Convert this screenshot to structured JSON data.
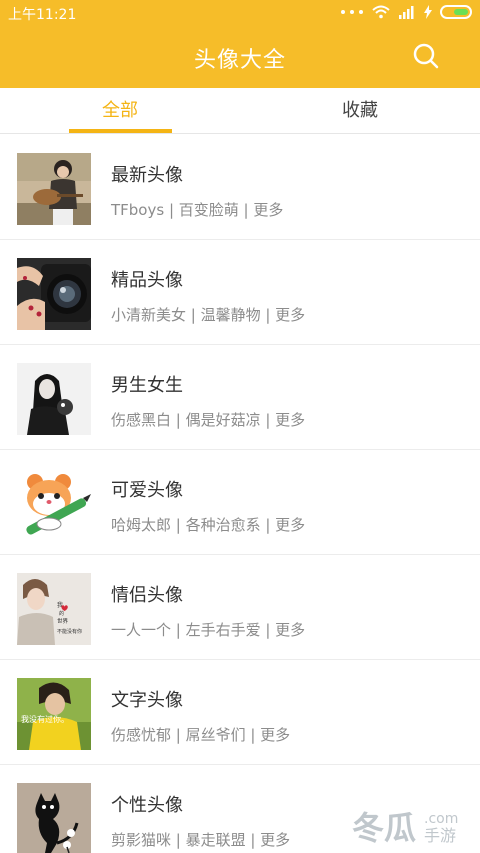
{
  "statusbar": {
    "time": "上午11:21"
  },
  "appbar": {
    "title": "头像大全"
  },
  "tabs": [
    {
      "label": "全部",
      "active": true
    },
    {
      "label": "收藏",
      "active": false
    }
  ],
  "items": [
    {
      "title": "最新头像",
      "subtitle": "TFboys | 百变脸萌 | 更多"
    },
    {
      "title": "精品头像",
      "subtitle": "小清新美女 | 温馨静物 | 更多"
    },
    {
      "title": "男生女生",
      "subtitle": "伤感黑白 | 偶是好菇凉 | 更多"
    },
    {
      "title": "可爱头像",
      "subtitle": "哈姆太郎 | 各种治愈系 | 更多"
    },
    {
      "title": "情侣头像",
      "subtitle": "一人一个 | 左手右手爱 | 更多"
    },
    {
      "title": "文字头像",
      "subtitle": "伤感忧郁 | 屌丝爷们 | 更多"
    },
    {
      "title": "个性头像",
      "subtitle": "剪影猫咪 | 暴走联盟 | 更多"
    }
  ],
  "thumb_text": {
    "couple": [
      "我",
      "的",
      "世界",
      "不能没有你"
    ],
    "text_avatar": "我没有过你。"
  },
  "watermark": {
    "text": "冬瓜",
    "sub": ".com",
    "sub2": "手游"
  },
  "colors": {
    "accent": "#f6bd29",
    "tab_active": "#f4b414"
  }
}
